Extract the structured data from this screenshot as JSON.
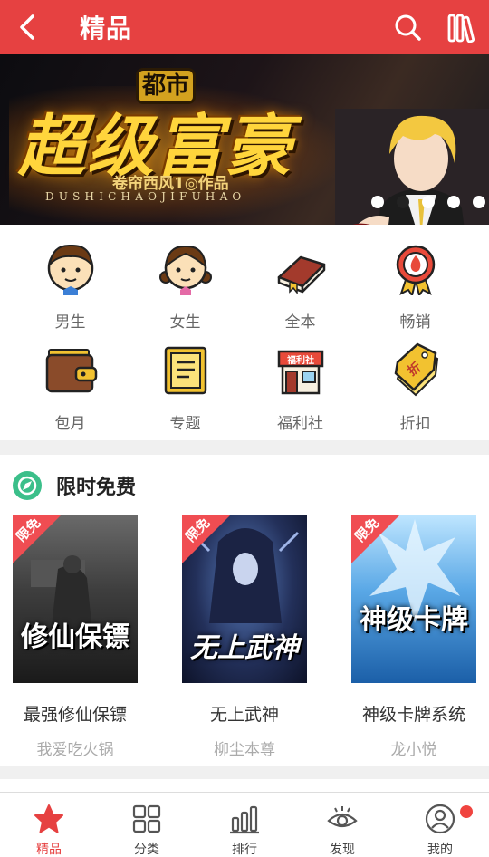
{
  "header": {
    "title": "精品",
    "back_icon": "back-arrow-icon",
    "search_icon": "search-icon",
    "bookshelf_icon": "bookshelf-icon",
    "bg_color": "#e64141"
  },
  "banner": {
    "tag": "都市",
    "title": "超级富豪",
    "author_line": "卷帘西风1◎作品",
    "pinyin": "DUSHICHAOJIFUHAO",
    "slide_count": 5,
    "active_slide": 2
  },
  "categories": [
    {
      "label": "男生",
      "icon": "boy-face-icon"
    },
    {
      "label": "女生",
      "icon": "girl-face-icon"
    },
    {
      "label": "全本",
      "icon": "book-icon"
    },
    {
      "label": "畅销",
      "icon": "fire-medal-icon"
    },
    {
      "label": "包月",
      "icon": "wallet-icon"
    },
    {
      "label": "专题",
      "icon": "clipboard-icon"
    },
    {
      "label": "福利社",
      "icon": "shop-icon"
    },
    {
      "label": "折扣",
      "icon": "discount-tag-icon"
    }
  ],
  "free_section": {
    "title": "限时免费",
    "icon": "compass-icon",
    "badge": "限免",
    "books": [
      {
        "name": "最强修仙保镖",
        "author": "我爱吃火锅",
        "cover_text": "修仙保镖",
        "cover_color": "#3a3a3a"
      },
      {
        "name": "无上武神",
        "author": "柳尘本尊",
        "cover_text": "无上武神",
        "cover_color": "#2a3f6a"
      },
      {
        "name": "神级卡牌系统",
        "author": "龙小悦",
        "cover_text": "神级卡牌",
        "cover_color": "#3d8fd0"
      }
    ]
  },
  "bottom_nav": [
    {
      "label": "精品",
      "icon": "star-icon",
      "active": true
    },
    {
      "label": "分类",
      "icon": "grid-icon",
      "active": false
    },
    {
      "label": "排行",
      "icon": "bar-chart-icon",
      "active": false
    },
    {
      "label": "发现",
      "icon": "eye-icon",
      "active": false
    },
    {
      "label": "我的",
      "icon": "user-icon",
      "active": false,
      "badge_dot": true
    }
  ]
}
